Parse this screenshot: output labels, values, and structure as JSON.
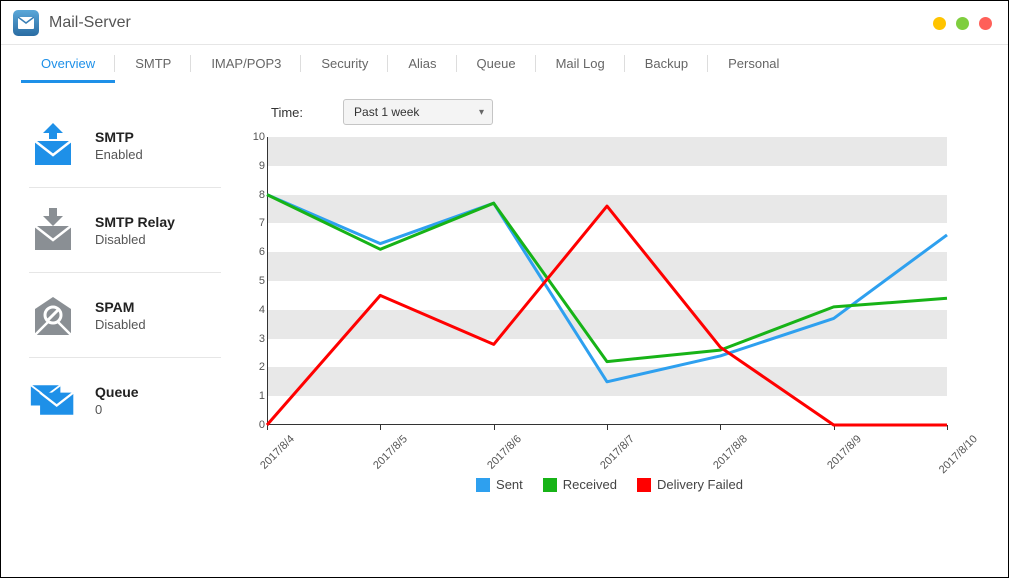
{
  "app": {
    "title": "Mail-Server"
  },
  "tabs": [
    {
      "label": "Overview",
      "active": true
    },
    {
      "label": "SMTP",
      "active": false
    },
    {
      "label": "IMAP/POP3",
      "active": false
    },
    {
      "label": "Security",
      "active": false
    },
    {
      "label": "Alias",
      "active": false
    },
    {
      "label": "Queue",
      "active": false
    },
    {
      "label": "Mail Log",
      "active": false
    },
    {
      "label": "Backup",
      "active": false
    },
    {
      "label": "Personal",
      "active": false
    }
  ],
  "sidebar": [
    {
      "title": "SMTP",
      "status": "Enabled",
      "icon": "smtp-out",
      "color": "#1e90e8"
    },
    {
      "title": "SMTP Relay",
      "status": "Disabled",
      "icon": "smtp-in",
      "color": "#8a8f94"
    },
    {
      "title": "SPAM",
      "status": "Disabled",
      "icon": "spam",
      "color": "#8a8f94"
    },
    {
      "title": "Queue",
      "status": "0",
      "icon": "queue",
      "color": "#1e90e8"
    }
  ],
  "time": {
    "label": "Time:",
    "selected": "Past 1 week"
  },
  "legend": {
    "sent": "Sent",
    "received": "Received",
    "failed": "Delivery Failed"
  },
  "colors": {
    "sent": "#2ea0ef",
    "received": "#17b317",
    "failed": "#ff0000"
  },
  "chart_data": {
    "type": "line",
    "title": "",
    "xlabel": "",
    "ylabel": "",
    "ylim": [
      0,
      10
    ],
    "categories": [
      "2017/8/4",
      "2017/8/5",
      "2017/8/6",
      "2017/8/7",
      "2017/8/8",
      "2017/8/9",
      "2017/8/10"
    ],
    "series": [
      {
        "name": "Sent",
        "color_key": "sent",
        "values": [
          8.0,
          6.3,
          7.7,
          1.5,
          2.4,
          3.7,
          6.6
        ]
      },
      {
        "name": "Received",
        "color_key": "received",
        "values": [
          8.0,
          6.1,
          7.7,
          2.2,
          2.6,
          4.1,
          4.4
        ]
      },
      {
        "name": "Delivery Failed",
        "color_key": "failed",
        "values": [
          0.0,
          4.5,
          2.8,
          7.6,
          2.7,
          0.0,
          0.0
        ]
      }
    ]
  }
}
